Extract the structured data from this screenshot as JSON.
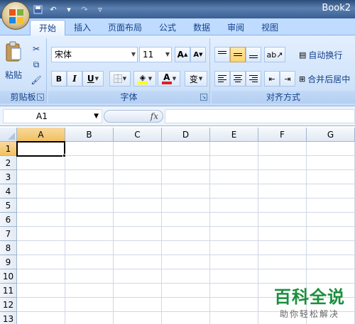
{
  "window": {
    "title": "Book2"
  },
  "tabs": [
    "开始",
    "插入",
    "页面布局",
    "公式",
    "数据",
    "审阅",
    "视图"
  ],
  "clipboard": {
    "paste_label": "粘贴",
    "group_label": "剪贴板"
  },
  "font": {
    "name": "宋体",
    "size": "11",
    "group_label": "字体",
    "bold": "B",
    "italic": "I",
    "underline": "U",
    "grow": "A",
    "shrink": "A",
    "font_color": "A",
    "phonetic": "变"
  },
  "alignment": {
    "group_label": "对齐方式",
    "wrap_text": "自动换行",
    "merge_center": "合并后居中"
  },
  "formula_bar": {
    "name_box": "A1",
    "fx": "fx"
  },
  "sheet": {
    "columns": [
      "A",
      "B",
      "C",
      "D",
      "E",
      "F",
      "G"
    ],
    "rows": [
      "1",
      "2",
      "3",
      "4",
      "5",
      "6",
      "7",
      "8",
      "9",
      "10",
      "11",
      "12",
      "13"
    ]
  },
  "watermark": {
    "title": "百科全说",
    "subtitle": "助你轻松解决"
  },
  "colors": {
    "accent": "#15428b",
    "ribbon": "#d3e5fb",
    "selection": "#f1c15f",
    "highlight": "#ffd36a",
    "font_red": "#e02020",
    "fill_yellow": "#ffff00"
  }
}
